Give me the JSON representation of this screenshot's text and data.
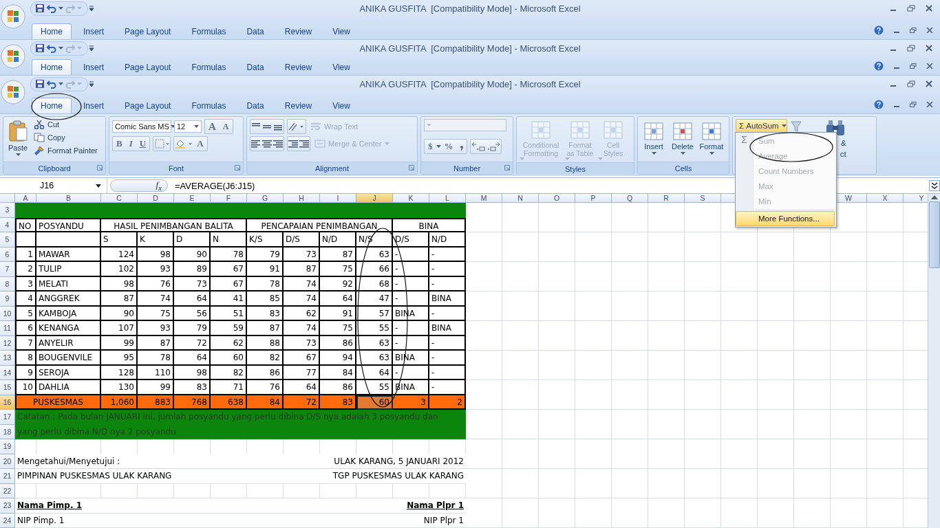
{
  "windows": [
    {
      "title": "ANIKA GUSFITA  [Compatibility Mode] - Microsoft Excel",
      "tabs": [
        {
          "label": "Home",
          "selected": true
        },
        {
          "label": "Insert",
          "selected": false
        },
        {
          "label": "Page Layout",
          "selected": false
        },
        {
          "label": "Formulas",
          "selected": false
        },
        {
          "label": "Data",
          "selected": false
        },
        {
          "label": "Review",
          "selected": false
        },
        {
          "label": "View",
          "selected": false
        }
      ]
    },
    {
      "title": "ANIKA GUSFITA  [Compatibility Mode] - Microsoft Excel",
      "tabs": [
        {
          "label": "Home",
          "selected": true
        },
        {
          "label": "Insert",
          "selected": false
        },
        {
          "label": "Page Layout",
          "selected": false
        },
        {
          "label": "Formulas",
          "selected": false
        },
        {
          "label": "Data",
          "selected": false
        },
        {
          "label": "Review",
          "selected": false
        },
        {
          "label": "View",
          "selected": false
        }
      ]
    },
    {
      "title": "ANIKA GUSFITA  [Compatibility Mode] - Microsoft Excel",
      "tabs": [
        {
          "label": "Home",
          "selected": true
        },
        {
          "label": "Insert",
          "selected": false
        },
        {
          "label": "Page Layout",
          "selected": false
        },
        {
          "label": "Formulas",
          "selected": false
        },
        {
          "label": "Data",
          "selected": false
        },
        {
          "label": "Review",
          "selected": false
        },
        {
          "label": "View",
          "selected": false
        }
      ]
    }
  ],
  "ribbon": {
    "clipboard": {
      "label": "Clipboard",
      "paste": "Paste",
      "items": [
        "Cut",
        "Copy",
        "Format Painter"
      ]
    },
    "font": {
      "label": "Font",
      "font_name": "Comic Sans MS",
      "font_size": "12",
      "size_buttons": [
        "A",
        "A"
      ],
      "style_buttons": [
        "B",
        "I",
        "U"
      ],
      "color_button": "A"
    },
    "alignment": {
      "label": "Alignment",
      "wrap": {
        "label": "Wrap Text",
        "disabled": true
      },
      "merge": {
        "label": "Merge & Center",
        "disabled": true
      }
    },
    "number": {
      "label": "Number",
      "currency": "$",
      "percent": "%",
      "disabled": true
    },
    "styles": {
      "label": "Styles",
      "buttons": [
        {
          "label": "Conditional Formatting",
          "disabled": true
        },
        {
          "label": "Format as Table",
          "disabled": true
        },
        {
          "label": "Cell Styles",
          "disabled": true
        }
      ]
    },
    "cells": {
      "label": "Cells",
      "buttons": [
        {
          "label": "Insert",
          "disabled": false
        },
        {
          "label": "Delete",
          "disabled": false
        },
        {
          "label": "Format",
          "disabled": false
        }
      ]
    },
    "editing": {
      "autosum": {
        "symbol": "Σ",
        "label": "AutoSum",
        "pressed": true
      },
      "find_fragments": [
        "&",
        "ct"
      ]
    }
  },
  "formula_bar": {
    "name_box": "J16",
    "fx": "f$_{x}$",
    "formula": "=AVERAGE(J6:J15)"
  },
  "sheet": {
    "columns": [
      {
        "label": "A",
        "selected": false
      },
      {
        "label": "B",
        "selected": false
      },
      {
        "label": "C",
        "selected": false
      },
      {
        "label": "D",
        "selected": false
      },
      {
        "label": "E",
        "selected": false
      },
      {
        "label": "F",
        "selected": false
      },
      {
        "label": "G",
        "selected": false
      },
      {
        "label": "H",
        "selected": false
      },
      {
        "label": "I",
        "selected": false
      },
      {
        "label": "J",
        "selected": true
      },
      {
        "label": "K",
        "selected": false
      },
      {
        "label": "L",
        "selected": false
      },
      {
        "label": "M",
        "selected": false
      },
      {
        "label": "N",
        "selected": false
      },
      {
        "label": "O",
        "selected": false
      },
      {
        "label": "P",
        "selected": false
      },
      {
        "label": "Q",
        "selected": false
      },
      {
        "label": "R",
        "selected": false
      },
      {
        "label": "S",
        "selected": false
      }
    ],
    "columns_right": [
      {
        "label": "W",
        "selected": false
      },
      {
        "label": "X",
        "selected": false
      },
      {
        "label": "Y",
        "selected": false
      }
    ],
    "rows": [
      {
        "label": "3",
        "selected": false
      },
      {
        "label": "4",
        "selected": false
      },
      {
        "label": "5",
        "selected": false
      },
      {
        "label": "6",
        "selected": false
      },
      {
        "label": "7",
        "selected": false
      },
      {
        "label": "8",
        "selected": false
      },
      {
        "label": "9",
        "selected": false
      },
      {
        "label": "10",
        "selected": false
      },
      {
        "label": "11",
        "selected": false
      },
      {
        "label": "12",
        "selected": false
      },
      {
        "label": "13",
        "selected": false
      },
      {
        "label": "14",
        "selected": false
      },
      {
        "label": "15",
        "selected": false
      },
      {
        "label": "16",
        "selected": true
      },
      {
        "label": "17",
        "selected": false
      },
      {
        "label": "18",
        "selected": false
      },
      {
        "label": "19",
        "selected": false
      },
      {
        "label": "20",
        "selected": false
      },
      {
        "label": "21",
        "selected": false
      },
      {
        "label": "22",
        "selected": false
      },
      {
        "label": "23",
        "selected": false
      },
      {
        "label": "24",
        "selected": false
      }
    ]
  },
  "table": {
    "header": [
      {
        "label": "NO"
      },
      {
        "label": "POSYANDU"
      },
      {
        "label": "HASIL PENIMBANGAN BALITA",
        "columns": [
          "S",
          "K",
          "D",
          "N"
        ]
      },
      {
        "label": "PENCAPAIAN PENIMBANGAN",
        "columns": [
          "K/S",
          "D/S",
          "N/D",
          "N/S"
        ]
      },
      {
        "label": "BINA",
        "columns": [
          "D/S",
          "N/D"
        ]
      }
    ],
    "rows": [
      {
        "no": "1",
        "name": "MAWAR",
        "values": [
          "124",
          "98",
          "90",
          "78",
          "79",
          "73",
          "87",
          "63",
          "-",
          "-"
        ]
      },
      {
        "no": "2",
        "name": "TULIP",
        "values": [
          "102",
          "93",
          "89",
          "67",
          "91",
          "87",
          "75",
          "66",
          "-",
          "-"
        ]
      },
      {
        "no": "3",
        "name": "MELATI",
        "values": [
          "98",
          "76",
          "73",
          "67",
          "78",
          "74",
          "92",
          "68",
          "-",
          "-"
        ]
      },
      {
        "no": "4",
        "name": "ANGGREK",
        "values": [
          "87",
          "74",
          "64",
          "41",
          "85",
          "74",
          "64",
          "47",
          "-",
          "BINA"
        ]
      },
      {
        "no": "5",
        "name": "KAMBOJA",
        "values": [
          "90",
          "75",
          "56",
          "51",
          "83",
          "62",
          "91",
          "57",
          "BINA",
          "-"
        ]
      },
      {
        "no": "6",
        "name": "KENANGA",
        "values": [
          "107",
          "93",
          "79",
          "59",
          "87",
          "74",
          "75",
          "55",
          "-",
          "BINA"
        ]
      },
      {
        "no": "7",
        "name": "ANYELIR",
        "values": [
          "99",
          "87",
          "72",
          "62",
          "88",
          "73",
          "86",
          "63",
          "-",
          "-"
        ]
      },
      {
        "no": "8",
        "name": "BOUGENVILE",
        "values": [
          "95",
          "78",
          "64",
          "60",
          "82",
          "67",
          "94",
          "63",
          "BINA",
          "-"
        ]
      },
      {
        "no": "9",
        "name": "SEROJA",
        "values": [
          "128",
          "110",
          "98",
          "82",
          "86",
          "77",
          "84",
          "64",
          "-",
          "-"
        ]
      },
      {
        "no": "10",
        "name": "DAHLIA",
        "values": [
          "130",
          "99",
          "83",
          "71",
          "76",
          "64",
          "86",
          "55",
          "BINA",
          "-"
        ]
      }
    ],
    "total": {
      "label": "PUSKESMAS",
      "values": [
        {
          "text": "1,060",
          "selected": false
        },
        {
          "text": "883",
          "selected": false
        },
        {
          "text": "768",
          "selected": false
        },
        {
          "text": "638",
          "selected": false
        },
        {
          "text": "84",
          "selected": false
        },
        {
          "text": "72",
          "selected": false
        },
        {
          "text": "83",
          "selected": false
        },
        {
          "text": "60",
          "selected": true
        },
        {
          "text": "3",
          "selected": false
        },
        {
          "text": "2",
          "selected": false
        }
      ]
    },
    "note": "Catatan : Pada bulan JANUARI ini, jumlah posyandu yang perlu dibina D/S nya adalah 3 posyandu dan yang perlu dibina N/D nya 2  posyandu",
    "footer": [
      {
        "kind": "plain",
        "left": "Mengetahui/Menyetujui :",
        "right": "ULAK KARANG, 5 JANUARI 2012"
      },
      {
        "kind": "plain",
        "left": "PIMPINAN PUSKESMAS ULAK KARANG",
        "right": "TGP PUSKESMAS ULAK KARANG"
      },
      {
        "kind": "name",
        "left": "Nama Pimp. 1",
        "right": "Nama Plpr 1"
      },
      {
        "kind": "plain",
        "left": "NIP Pimp. 1",
        "right": "NIP Plpr 1"
      }
    ]
  },
  "autosum_menu": {
    "symbol": "Σ",
    "items": [
      {
        "label": "Sum",
        "disabled": true,
        "highlighted": false
      },
      {
        "label": "Average",
        "disabled": true,
        "highlighted": false
      },
      {
        "label": "Count Numbers",
        "disabled": true,
        "highlighted": false
      },
      {
        "label": "Max",
        "disabled": true,
        "highlighted": false
      },
      {
        "label": "Min",
        "disabled": true,
        "highlighted": false
      },
      {
        "label": "More Functions...",
        "disabled": false,
        "highlighted": true
      }
    ]
  }
}
